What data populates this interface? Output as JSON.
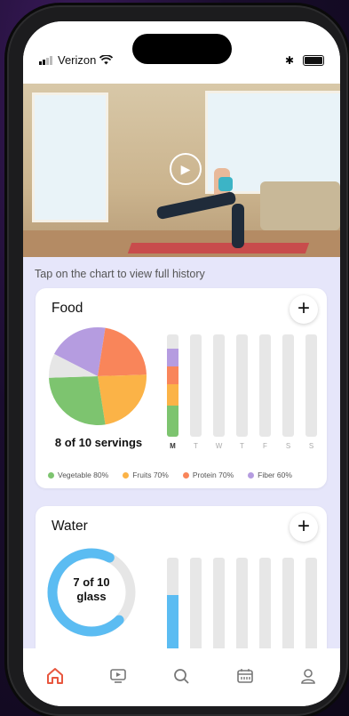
{
  "status": {
    "carrier": "Verizon"
  },
  "video": {
    "play_icon": "play-icon"
  },
  "hint": "Tap on the chart to view full history",
  "food": {
    "title": "Food",
    "summary": "8 of 10 servings",
    "pie": [
      {
        "name": "Vegetable",
        "value": 40,
        "color": "#7dc46f"
      },
      {
        "name": "Fruits",
        "value": 25,
        "color": "#fbb347"
      },
      {
        "name": "Protein",
        "value": 20,
        "color": "#f9855a"
      },
      {
        "name": "Fiber",
        "value": 15,
        "color": "#b59ce0"
      },
      {
        "name": "Empty",
        "value": 0,
        "color": "#e6e6e6"
      }
    ],
    "days": [
      "M",
      "T",
      "W",
      "T",
      "F",
      "S",
      "S"
    ],
    "legend": [
      {
        "label": "Vegetable 80%",
        "color": "#7dc46f"
      },
      {
        "label": "Fruits 70%",
        "color": "#fbb347"
      },
      {
        "label": "Protein 70%",
        "color": "#f9855a"
      },
      {
        "label": "Fiber 60%",
        "color": "#b59ce0"
      }
    ]
  },
  "water": {
    "title": "Water",
    "summary_line1": "7 of 10",
    "summary_line2": "glass",
    "progress": 0.7,
    "color": "#5bbcf2",
    "days_progress": [
      0.6,
      0,
      0,
      0,
      0,
      0,
      0
    ]
  },
  "tabs": [
    "home-icon",
    "video-icon",
    "search-icon",
    "calendar-icon",
    "profile-icon"
  ],
  "accent": "#e8573f"
}
